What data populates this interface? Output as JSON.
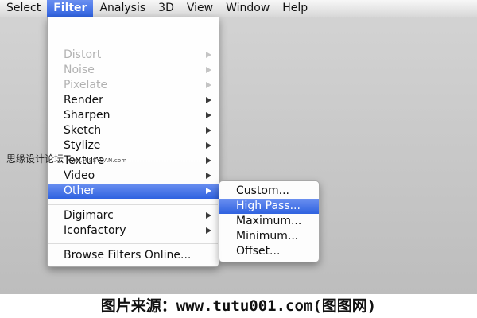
{
  "menubar": {
    "items": [
      "Select",
      "Filter",
      "Analysis",
      "3D",
      "View",
      "Window",
      "Help"
    ],
    "active": "Filter"
  },
  "filter_menu": {
    "items": [
      {
        "label": "Distort",
        "enabled": false,
        "submenu": true
      },
      {
        "label": "Noise",
        "enabled": false,
        "submenu": true
      },
      {
        "label": "Pixelate",
        "enabled": false,
        "submenu": true
      },
      {
        "label": "Render",
        "enabled": true,
        "submenu": true
      },
      {
        "label": "Sharpen",
        "enabled": true,
        "submenu": true
      },
      {
        "label": "Sketch",
        "enabled": true,
        "submenu": true
      },
      {
        "label": "Stylize",
        "enabled": true,
        "submenu": true
      },
      {
        "label": "Texture",
        "enabled": true,
        "submenu": true
      },
      {
        "label": "Video",
        "enabled": true,
        "submenu": true
      },
      {
        "label": "Other",
        "enabled": true,
        "submenu": true,
        "highlighted": true
      },
      {
        "label": "Digimarc",
        "enabled": true,
        "submenu": true
      },
      {
        "label": "Iconfactory",
        "enabled": true,
        "submenu": true
      },
      {
        "label": "Browse Filters Online...",
        "enabled": true,
        "submenu": false
      }
    ]
  },
  "other_submenu": {
    "items": [
      {
        "label": "Custom...",
        "highlighted": false
      },
      {
        "label": "High Pass...",
        "highlighted": true
      },
      {
        "label": "Maximum...",
        "highlighted": false
      },
      {
        "label": "Minimum...",
        "highlighted": false
      },
      {
        "label": "Offset...",
        "highlighted": false
      }
    ]
  },
  "watermark": {
    "text": "思缘设计论坛",
    "url": "www.MISSYUAN.com"
  },
  "caption": "图片来源：www.tutu001.com(图图网)",
  "colors": {
    "highlight": "#2f62e0",
    "disabled_text": "#b2b2b2",
    "background": "#c8c8c8"
  }
}
